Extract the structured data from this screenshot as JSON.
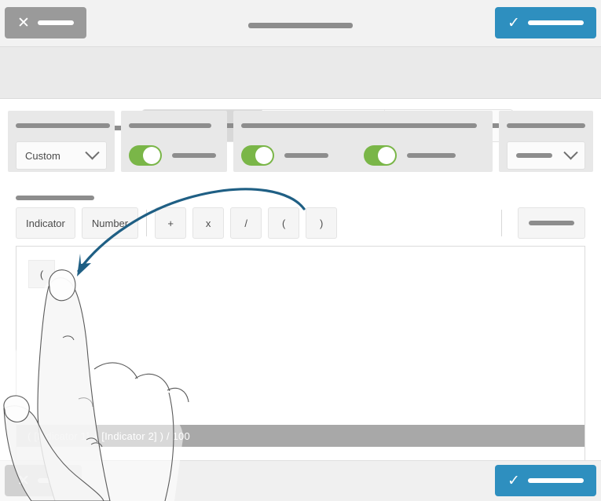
{
  "window": {
    "title_redacted": true
  },
  "topbar": {
    "cancel": {
      "icon": "close-icon",
      "glyph": "✕",
      "label_redacted": true
    },
    "confirm": {
      "icon": "check-icon",
      "glyph": "✓",
      "label_redacted": true
    }
  },
  "mode_selector": {
    "label_redacted": true,
    "options": [
      {
        "id": "option-1",
        "selected": true
      },
      {
        "id": "option-2",
        "selected": false
      },
      {
        "id": "option-3",
        "selected": false
      }
    ]
  },
  "panels": [
    {
      "id": "panel-format",
      "title_redacted": true,
      "control": "dropdown",
      "dropdown_value": "Custom"
    },
    {
      "id": "panel-toggle-single",
      "title_redacted": true,
      "control": "toggle",
      "toggles": [
        {
          "on": true,
          "label_redacted": true
        }
      ]
    },
    {
      "id": "panel-toggle-pair",
      "title_redacted": true,
      "control": "toggle",
      "toggles": [
        {
          "on": true,
          "label_redacted": true
        },
        {
          "on": true,
          "label_redacted": true
        }
      ]
    },
    {
      "id": "panel-select",
      "title_redacted": true,
      "control": "dropdown",
      "dropdown_value": ""
    }
  ],
  "formula": {
    "section_label_redacted": true,
    "toolbar": {
      "indicator_label": "Indicator",
      "number_label": "Number",
      "operators": [
        "+",
        "x",
        "/",
        "(",
        ")"
      ],
      "extra_button_redacted": true
    },
    "editor": {
      "tokens": [
        "("
      ],
      "expression": "( [Indicator 1] + [Indicator 2] ) / 100"
    }
  },
  "bottombar": {
    "cancel": {
      "icon": "close-icon",
      "glyph": "✕",
      "label_redacted": true
    },
    "confirm": {
      "icon": "check-icon",
      "glyph": "✓",
      "label_redacted": true
    }
  },
  "annotation": {
    "arrow_color": "#1f5f84",
    "arrow_from": "open-paren-toolbar-button",
    "arrow_to": "open-paren-editor-token"
  },
  "colors": {
    "accent_blue": "#2e8fbf",
    "toggle_green": "#7ab648",
    "cancel_gray": "#9a9a9a",
    "statusbar_gray": "#a8a8a8"
  }
}
